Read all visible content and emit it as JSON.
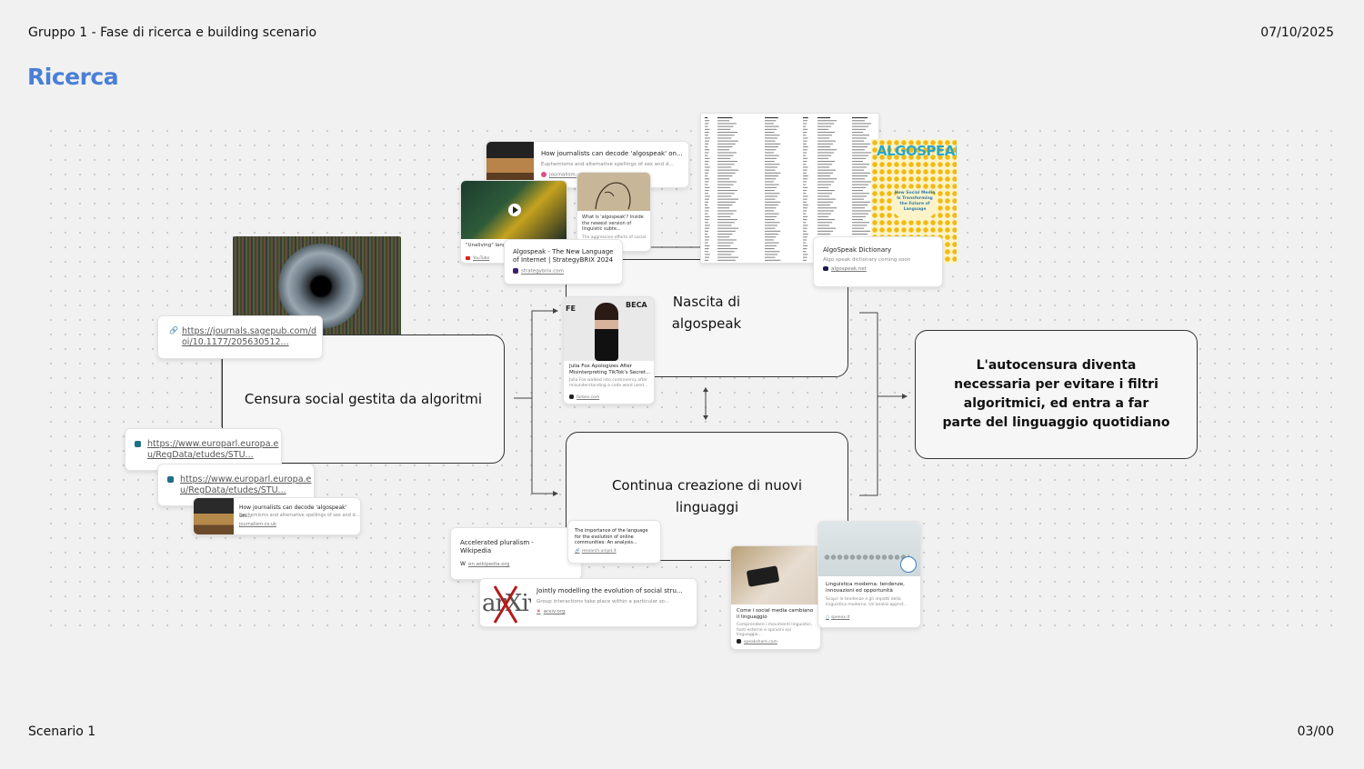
{
  "header": {
    "left": "Gruppo 1 - Fase di ricerca e building scenario",
    "date": "07/10/2025"
  },
  "page_title": "Ricerca",
  "footer": {
    "left": "Scenario 1",
    "right": "03/00"
  },
  "diagram": {
    "nodes": {
      "censura": "Censura social gestita da algoritmi",
      "nascita": "Nascita di algospeak",
      "continua": "Continua creazione di nuovi linguaggi",
      "conclusione": "L'autocensura diventa necessaria per evitare i filtri algoritmici, ed entra a far parte del linguaggio quotidiano"
    },
    "links": {
      "sagepub": "https://journals.sagepub.com/doi/10.1177/205630512...",
      "europarl_1": "https://www.europarl.europa.eu/RegData/etudes/STU...",
      "europarl_2": "https://www.europarl.europa.eu/RegData/etudes/STU..."
    },
    "cards": {
      "journalism_top": {
        "title": "How journalists can decode 'algospeak' on...",
        "desc": "Euphemisms and alternative spellings of sex and d...",
        "url": "journalism.co.uk"
      },
      "journalism_bottom": {
        "title": "How journalists can decode 'algospeak' on...",
        "desc": "Euphemisms and alternative spellings of sex and d...",
        "url": "journalism.co.uk"
      },
      "unaliving": {
        "title": "\"Unaliving\" language m... journalism",
        "url": "YouTube"
      },
      "what_is_algospeak": {
        "title": "What is 'algospeak'? Inside the newest version of linguistic subte...",
        "desc": "The aggressive efforts of social media..."
      },
      "strategybrix": {
        "title": "Algospeak - The New Language of Internet | StrategyBRIX 2024",
        "url": "strategybrix.com"
      },
      "dictionary": {
        "title": "AlgoSpeak Dictionary",
        "desc": "Algo speak dictionary coming soon",
        "url": "algospeak.net"
      },
      "algospeak_cover": {
        "title": "ALGOSPEAK",
        "subtitle": "How Social Media Is Transforming the Future of Language"
      },
      "julia_fox": {
        "title": "Julia Fox Apologizes After Misinterpreting TikTok's Secret...",
        "desc": "Julia Fox walked into controversy after misunderstanding a code word used...",
        "url": "forbes.com"
      },
      "wikipedia": {
        "title": "Accelerated pluralism - Wikipedia",
        "url": "en.wikipedia.org"
      },
      "importance": {
        "title": "The importance of the language for the evolution of online communities: An analysis...",
        "url": "research.unipd.it"
      },
      "arxiv": {
        "title": "Jointly modelling the evolution of social stru...",
        "desc": "Group interactions take place within a particular so...",
        "url": "arxiv.org",
        "logo": "arXiv"
      },
      "social_media": {
        "title": "Come i social media cambiano il linguaggio",
        "desc": "Comprendere i movimenti linguistici, fonti esterne e opinioni sui linguaggio...",
        "url": "speakshare.com"
      },
      "linguistica": {
        "title": "Linguistica moderna: tendenze, innovazioni ed opportunità",
        "desc": "Scopri le tendenze e gli impatti della linguistica moderna. Un'analisi approf...",
        "url": "speexx.it"
      }
    }
  },
  "colors": {
    "accent": "#4a7fd6",
    "background": "#f1f1f1",
    "node_border": "#333333"
  }
}
